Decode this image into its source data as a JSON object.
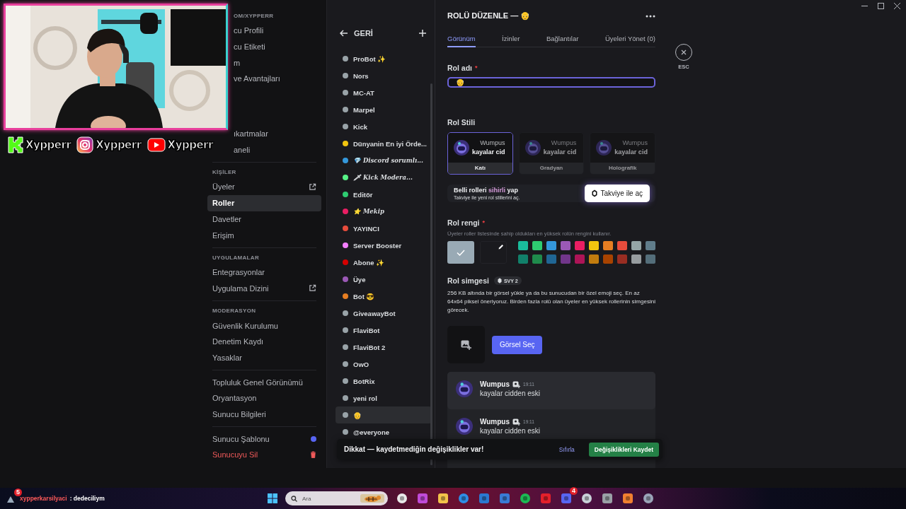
{
  "stream_overlay": {
    "socials": [
      {
        "kind": "kick",
        "handle": "Xypperr"
      },
      {
        "kind": "instagram",
        "handle": "Xypperr"
      },
      {
        "kind": "youtube",
        "handle": "Xypperr"
      }
    ]
  },
  "sidebar": {
    "sections": [
      {
        "kind": "cut",
        "header": "OM/XYPPERR",
        "items": [
          {
            "label": "cu Profili",
            "kind": "plain",
            "selected": false
          },
          {
            "label": "cu Etiketi",
            "kind": "plain",
            "selected": false
          },
          {
            "label": "m",
            "kind": "plain",
            "selected": false
          },
          {
            "label": "ve Avantajları",
            "kind": "plain",
            "selected": false
          }
        ]
      },
      {
        "kind": "cut",
        "items": [
          {
            "label": "ıkartmalar",
            "kind": "plain",
            "selected": false
          },
          {
            "label": "aneli",
            "kind": "plain",
            "selected": false
          }
        ]
      },
      {
        "kind": "full",
        "header": "KİŞİLER",
        "items": [
          {
            "label": "Üyeler",
            "kind": "link",
            "selected": false
          },
          {
            "label": "Roller",
            "kind": "plain",
            "selected": true
          },
          {
            "label": "Davetler",
            "kind": "plain",
            "selected": false
          },
          {
            "label": "Erişim",
            "kind": "plain",
            "selected": false
          }
        ]
      },
      {
        "kind": "full",
        "header": "UYGULAMALAR",
        "items": [
          {
            "label": "Entegrasyonlar",
            "kind": "plain",
            "selected": false
          },
          {
            "label": "Uygulama Dizini",
            "kind": "link",
            "selected": false
          }
        ]
      },
      {
        "kind": "full",
        "header": "MODERASYON",
        "items": [
          {
            "label": "Güvenlik Kurulumu",
            "kind": "plain",
            "selected": false
          },
          {
            "label": "Denetim Kaydı",
            "kind": "plain",
            "selected": false
          },
          {
            "label": "Yasaklar",
            "kind": "plain",
            "selected": false
          }
        ]
      },
      {
        "kind": "full",
        "items": [
          {
            "label": "Topluluk Genel Görünümü",
            "kind": "plain",
            "selected": false
          },
          {
            "label": "Oryantasyon",
            "kind": "plain",
            "selected": false
          },
          {
            "label": "Sunucu Bilgileri",
            "kind": "plain",
            "selected": false
          }
        ]
      },
      {
        "kind": "full",
        "items": [
          {
            "label": "Sunucu Şablonu",
            "kind": "dot",
            "selected": false
          },
          {
            "label": "Sunucuyu Sil",
            "kind": "danger",
            "selected": false
          }
        ]
      }
    ]
  },
  "roles": {
    "back": "GERİ",
    "items": [
      {
        "name": "ProBot ✨",
        "kind": "plain",
        "color": "#99a3a8",
        "selected": false
      },
      {
        "name": "Nors",
        "kind": "plain",
        "color": "#99a3a8",
        "selected": false
      },
      {
        "name": "MC-AT",
        "kind": "plain",
        "color": "#99a3a8",
        "selected": false
      },
      {
        "name": "Marpel",
        "kind": "plain",
        "color": "#99a3a8",
        "selected": false
      },
      {
        "name": "Kick",
        "kind": "plain",
        "color": "#99a3a8",
        "selected": false
      },
      {
        "name": "Dünyanin En iyi Örde...",
        "kind": "plain",
        "color": "#f1c40f",
        "selected": false
      },
      {
        "name": "💎 Discord sorumlı...",
        "kind": "fancy",
        "color": "#3498db",
        "selected": false
      },
      {
        "name": "🗡 Kick Modera...",
        "kind": "fancy",
        "color": "#57f287",
        "selected": false
      },
      {
        "name": "Editör",
        "kind": "plain",
        "color": "#2ecc71",
        "selected": false
      },
      {
        "name": "⭐ Mekip",
        "kind": "fancy",
        "color": "#e91e63",
        "selected": false
      },
      {
        "name": "YAYINCI",
        "kind": "plain",
        "color": "#e74c3c",
        "selected": false
      },
      {
        "name": "Server Booster",
        "kind": "plain",
        "color": "#f47fff",
        "selected": false
      },
      {
        "name": "Abone ✨",
        "kind": "plain",
        "color": "#d50000",
        "selected": false
      },
      {
        "name": "Üye",
        "kind": "plain",
        "color": "#9b59b6",
        "selected": false
      },
      {
        "name": "Bot 😎",
        "kind": "plain",
        "color": "#e67e22",
        "selected": false
      },
      {
        "name": "GiveawayBot",
        "kind": "plain",
        "color": "#99a3a8",
        "selected": false
      },
      {
        "name": "FlaviBot",
        "kind": "plain",
        "color": "#99a3a8",
        "selected": false
      },
      {
        "name": "FlaviBot 2",
        "kind": "plain",
        "color": "#99a3a8",
        "selected": false
      },
      {
        "name": "OwO",
        "kind": "plain",
        "color": "#99a3a8",
        "selected": false
      },
      {
        "name": "BotRix",
        "kind": "plain",
        "color": "#99a3a8",
        "selected": false
      },
      {
        "name": "yeni rol",
        "kind": "plain",
        "color": "#99a3a8",
        "selected": false
      },
      {
        "name": "👴",
        "kind": "plain",
        "color": "#99a3a8",
        "selected": true
      },
      {
        "name": "@everyone",
        "kind": "plain",
        "color": "#99a3a8",
        "selected": false
      }
    ]
  },
  "editor": {
    "title": "ROLÜ DÜZENLE — 👴",
    "close_label": "ESC",
    "tabs": [
      {
        "label": "Görünüm",
        "selected": true
      },
      {
        "label": "İzinler",
        "selected": false
      },
      {
        "label": "Bağlantılar",
        "selected": false
      },
      {
        "label": "Üyeleri Yönet (0)",
        "selected": false
      }
    ],
    "name_field": {
      "label": "Rol adı",
      "required_mark": "*",
      "value": "👴",
      "focused": true
    },
    "style": {
      "label": "Rol Stili",
      "options": [
        {
          "label": "Katı",
          "preview_name": "Wumpus",
          "preview_text": "kayalar cid",
          "selected": true,
          "disabled": false
        },
        {
          "label": "Gradyan",
          "preview_name": "Wumpus",
          "preview_text": "kayalar cid",
          "selected": false,
          "disabled": true
        },
        {
          "label": "Holografik",
          "preview_name": "Wumpus",
          "preview_text": "kayalar cid",
          "selected": false,
          "disabled": true
        }
      ]
    },
    "boost": {
      "title": "Belli rolleri ",
      "highlight": "sihirli",
      "title_end": " yap",
      "subtitle": "Takviye ile yeni rol stillerini aç.",
      "button": "Takviye ile aç"
    },
    "color": {
      "label": "Rol rengi",
      "required_mark": "*",
      "hint": "Üyeler roller listesinde sahip oldukları en yüksek rolün rengini kullanır.",
      "default": {
        "color": "#99aab5",
        "selected": true
      },
      "custom": {
        "selected": false
      },
      "swatches": [
        {
          "color": "#1abc9c",
          "selected": false
        },
        {
          "color": "#2ecc71",
          "selected": false
        },
        {
          "color": "#3498db",
          "selected": false
        },
        {
          "color": "#9b59b6",
          "selected": false
        },
        {
          "color": "#e91e63",
          "selected": false
        },
        {
          "color": "#f1c40f",
          "selected": false
        },
        {
          "color": "#e67e22",
          "selected": false
        },
        {
          "color": "#e74c3c",
          "selected": false
        },
        {
          "color": "#95a5a6",
          "selected": false
        },
        {
          "color": "#607d8b",
          "selected": false
        },
        {
          "color": "#11806a",
          "selected": false
        },
        {
          "color": "#1f8b4c",
          "selected": false
        },
        {
          "color": "#206694",
          "selected": false
        },
        {
          "color": "#71368a",
          "selected": false
        },
        {
          "color": "#ad1457",
          "selected": false
        },
        {
          "color": "#c27c0e",
          "selected": false
        },
        {
          "color": "#a84300",
          "selected": false
        },
        {
          "color": "#992d22",
          "selected": false
        },
        {
          "color": "#979c9f",
          "selected": false
        },
        {
          "color": "#546e7a",
          "selected": false
        }
      ]
    },
    "icon": {
      "label": "Rol simgesi",
      "badge": "SVY 2",
      "description": "256 KB altında bir görsel yükle ya da bu sunucudan bir özel emoji seç. En az 64x64 piksel öneriyoruz. Birden fazla rolü olan üyeler en yüksek rollerinin simgesini görecek.",
      "button": "Görsel Seç"
    },
    "preview": {
      "messages": [
        {
          "author": "Wumpus",
          "time": "19:11",
          "text": "kayalar cidden eski"
        },
        {
          "author": "Wumpus",
          "time": "19:11",
          "text": "kayalar cidden eski"
        }
      ]
    }
  },
  "toast": {
    "message": "Dikkat — kaydetmediğin değişiklikler var!",
    "reset": "Sıfırla",
    "save": "Değişiklikleri Kaydet"
  },
  "taskbar": {
    "chat_user": "xypperkarsilyaci",
    "chat_text": ": dedeciliym",
    "chat_badge": "5",
    "search_placeholder": "Ara",
    "discord_badge": "4"
  }
}
